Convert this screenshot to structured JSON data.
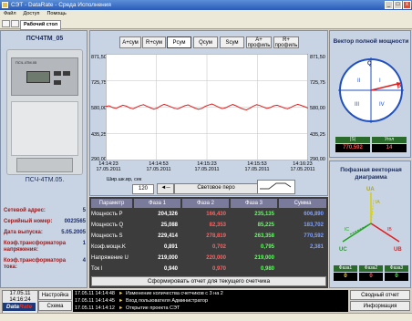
{
  "window": {
    "title": "СЭТ - DataRate - Среда Исполнения"
  },
  "menu": [
    "Файл",
    "Доступ",
    "Помощь"
  ],
  "toolbar": {
    "tab": "Рабочий стол"
  },
  "device": {
    "title": "ПСЧ4ТМ_05",
    "model_on_device": "ПСЧ-4ТМ.05",
    "caption": "ПСЧ-4ТМ.05.",
    "params": [
      {
        "label": "Сетевой адрес:",
        "value": "5"
      },
      {
        "label": "Серийный номер:",
        "value": "0023565"
      },
      {
        "label": "Дата выпуска:",
        "value": "5.05.2005"
      },
      {
        "label": "Коэф.трансформатора напряжения:",
        "value": "1"
      },
      {
        "label": "Коэф.трансформатора тока:",
        "value": "4"
      }
    ]
  },
  "modes": {
    "buttons": [
      "A+сум",
      "R+сум",
      "Pсум",
      "Qсум",
      "Sсум",
      "A+ профиль",
      "R+ профиль"
    ],
    "selected": "Pсум"
  },
  "chart_data": {
    "type": "line",
    "y_left_ticks": [
      "871,50",
      "725,75",
      "580,00",
      "435,25",
      "290,00"
    ],
    "y_right_ticks": [
      "871,50",
      "725,75",
      "580,00",
      "435,25",
      "290,00"
    ],
    "x_ticks": [
      {
        "time": "14:14:23",
        "date": "17.05.2011"
      },
      {
        "time": "14:14:53",
        "date": "17.05.2011"
      },
      {
        "time": "14:15:23",
        "date": "17.05.2011"
      },
      {
        "time": "14:15:53",
        "date": "17.05.2011"
      },
      {
        "time": "14:16:23",
        "date": "17.05.2011"
      }
    ],
    "ylim": [
      290.0,
      871.5
    ],
    "series": [
      {
        "color": "#e02020",
        "values": [
          584,
          588,
          579,
          574,
          583,
          591,
          586,
          577,
          572,
          581,
          589,
          594,
          585,
          578,
          570,
          576,
          587,
          596,
          590,
          582,
          575,
          571,
          580,
          588,
          593,
          584,
          576,
          569,
          574,
          585,
          592,
          598,
          589,
          580,
          573,
          578,
          587,
          595,
          588,
          579,
          571,
          566,
          575,
          586,
          594,
          589,
          581,
          574,
          579,
          588,
          591,
          584,
          577,
          572,
          580,
          589,
          596,
          590,
          583,
          576
        ]
      }
    ],
    "grid": true
  },
  "scale": {
    "label": "Шир.шк.вр, сек",
    "value": "120",
    "lightpen": "Световое перо"
  },
  "table": {
    "headers": [
      "Параметр",
      "Фаза 1",
      "Фаза 2",
      "Фаза 3",
      "Сумма"
    ],
    "rows": [
      {
        "label": "Мощность P",
        "values": [
          "204,326",
          "166,430",
          "235,135",
          "606,890"
        ]
      },
      {
        "label": "Мощность Q",
        "values": [
          "25,088",
          "82,353",
          "85,225",
          "183,702"
        ]
      },
      {
        "label": "Мощность S",
        "values": [
          "229,414",
          "278,819",
          "263,358",
          "770,592"
        ]
      },
      {
        "label": "Коэф.мощн.K",
        "values": [
          "0,891",
          "0,702",
          "0,795",
          "2,381"
        ]
      },
      {
        "label": "Напряжение U",
        "values": [
          "219,000",
          "220,000",
          "219,000",
          ""
        ]
      },
      {
        "label": "Ток I",
        "values": [
          "0,940",
          "0,970",
          "0,980",
          ""
        ]
      }
    ],
    "report_button": "Сформировать отчет для текущего счетчика"
  },
  "vector_panel": {
    "title": "Вектор полной мощности",
    "axes": {
      "top": "Q",
      "right": "P"
    },
    "quadrants": [
      "I",
      "II",
      "III",
      "IV"
    ],
    "readouts": [
      {
        "label": "|S|",
        "value": "770,592"
      },
      {
        "label": "Угол",
        "value": "14"
      }
    ]
  },
  "phase_panel": {
    "title": "Пофазная векторная диаграмма",
    "labels": [
      "UA",
      "UB",
      "UC",
      "IA",
      "IB",
      "IC"
    ],
    "readouts": [
      {
        "label": "Фаза1",
        "value": "0"
      },
      {
        "label": "Фаза2",
        "value": "0"
      },
      {
        "label": "Фаза3",
        "value": "0"
      }
    ]
  },
  "bottom": {
    "date": "17.05.11",
    "time": "14:16:24",
    "logo_a": "Data",
    "logo_b": "Rate",
    "left_buttons": [
      "Настройка",
      "Схема подстанции"
    ],
    "right_buttons": [
      "Сводный отчет",
      "Информация"
    ],
    "log": [
      {
        "time": "17.05.11 14:14:48",
        "text": "Изменение количества счетчиков с 3 на 2"
      },
      {
        "time": "17.05.11 14:14:45",
        "text": "Вход пользователя Администратор"
      },
      {
        "time": "17.05.11 14:14:12",
        "text": "Открытие проекта СЭТ"
      }
    ]
  },
  "colors": {
    "curve": "#e02020",
    "table_bg": "#3c3c3c",
    "phase1": "#ffffff",
    "phase2": "#ff6060",
    "phase3": "#60ff60",
    "sum": "#7fa0ff"
  }
}
